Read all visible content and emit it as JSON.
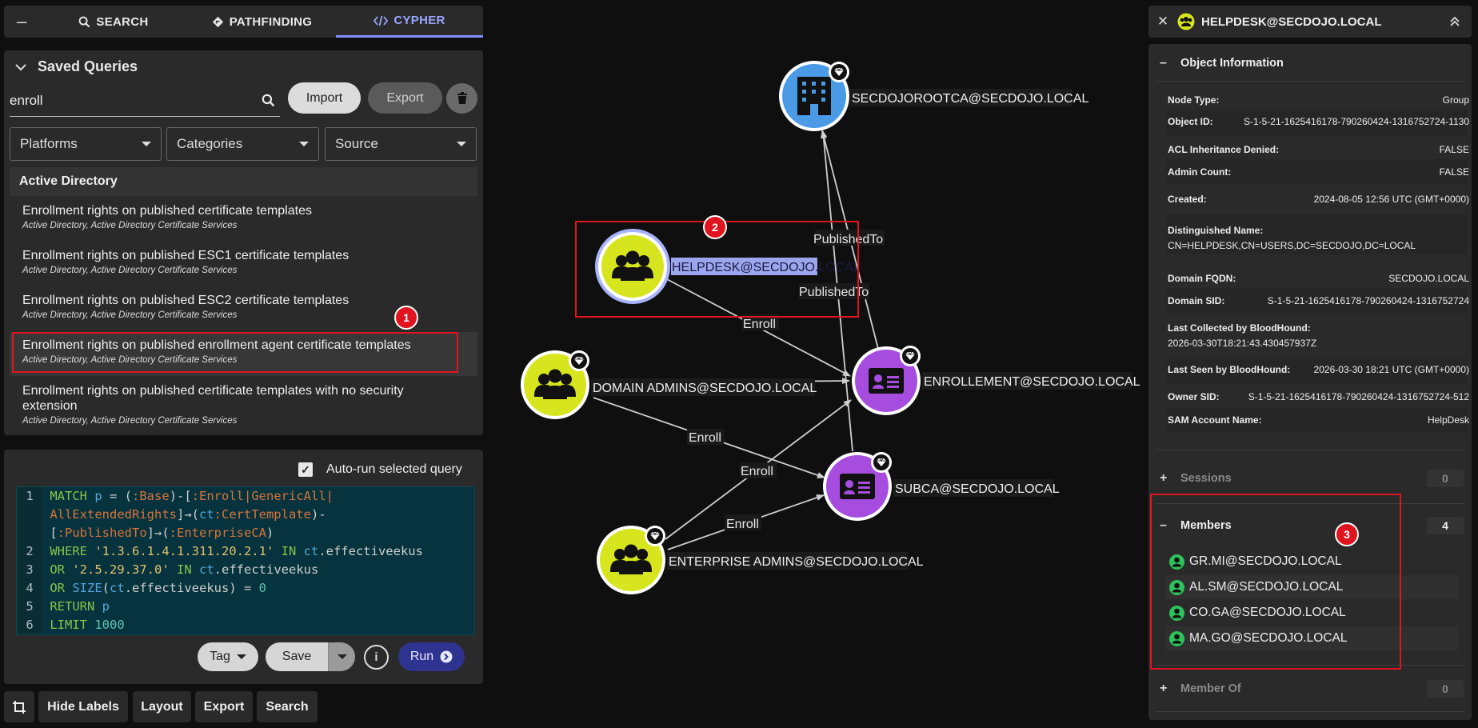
{
  "tabs": [
    {
      "label": "SEARCH"
    },
    {
      "label": "PATHFINDING"
    },
    {
      "label": "CYPHER"
    }
  ],
  "saved_queries": {
    "title": "Saved Queries",
    "search_value": "enroll",
    "import_label": "Import",
    "export_label": "Export",
    "filters": {
      "platforms": "Platforms",
      "categories": "Categories",
      "source": "Source"
    },
    "group_heading": "Active Directory",
    "items": [
      {
        "title": "Enrollment rights on published certificate templates",
        "subtitle": "Active Directory, Active Directory Certificate Services"
      },
      {
        "title": "Enrollment rights on published ESC1 certificate templates",
        "subtitle": "Active Directory, Active Directory Certificate Services"
      },
      {
        "title": "Enrollment rights on published ESC2 certificate templates",
        "subtitle": "Active Directory, Active Directory Certificate Services"
      },
      {
        "title": "Enrollment rights on published enrollment agent certificate templates",
        "subtitle": "Active Directory, Active Directory Certificate Services"
      },
      {
        "title": "Enrollment rights on published certificate templates with no security extension",
        "subtitle": "Active Directory, Active Directory Certificate Services"
      }
    ]
  },
  "cypher": {
    "autorun_label": "Auto-run selected query",
    "autorun_checked": true,
    "line_numbers": [
      "1",
      "2",
      "3",
      "4",
      "5",
      "6"
    ],
    "tokens": {
      "l1a_kw": "MATCH ",
      "l1a_var": "p",
      "l1a_op": " = (",
      "l1a_lbl1": ":Base",
      "l1a_op2": ")-[",
      "l1a_lbl2": ":Enroll|GenericAll|",
      "l1b_lbl": "AllExtendedRights",
      "l1b_op": "]→(",
      "l1b_var": "ct",
      "l1b_lbl2": ":CertTemplate",
      "l1b_op2": ")-",
      "l1c_op": "[",
      "l1c_lbl": ":PublishedTo",
      "l1c_op2": "]→(",
      "l1c_lbl2": ":EnterpriseCA",
      "l1c_op3": ")",
      "l2_kw": "WHERE ",
      "l2_str": "'1.3.6.1.4.1.311.20.2.1'",
      "l2_kw2": " IN ",
      "l2_var": "ct",
      "l2_prop": ".effectiveekus",
      "l3_kw": "OR ",
      "l3_str": "'2.5.29.37.0'",
      "l3_kw2": " IN ",
      "l3_var": "ct",
      "l3_prop": ".effectiveekus",
      "l4_kw": "OR ",
      "l4_fn": "SIZE",
      "l4_op": "(",
      "l4_var": "ct",
      "l4_prop": ".effectiveekus) = ",
      "l4_num": "0",
      "l5_kw": "RETURN ",
      "l5_var": "p",
      "l6_kw": "LIMIT ",
      "l6_num": "1000"
    },
    "tag_label": "Tag",
    "save_label": "Save",
    "run_label": "Run"
  },
  "bottom_toolbar": {
    "hide_labels": "Hide Labels",
    "layout": "Layout",
    "export": "Export",
    "search": "Search"
  },
  "graph": {
    "nodes": {
      "rootca": "SECDOJOROOTCA@SECDOJO.LOCAL",
      "helpdesk": "HELPDESK@SECDOJO.LOCAL",
      "domain_admins": "DOMAIN ADMINS@SECDOJO.LOCAL",
      "enrollement": "ENROLLEMENT@SECDOJO.LOCAL",
      "subca": "SUBCA@SECDOJO.LOCAL",
      "enterprise_admins": "ENTERPRISE ADMINS@SECDOJO.LOCAL"
    },
    "edge_labels": {
      "published_to_1": "PublishedTo",
      "published_to_2": "PublishedTo",
      "enroll_helpdesk": "Enroll",
      "enroll_da_subca": "Enroll",
      "enroll_ea_enr": "Enroll",
      "enroll_ea_subca": "Enroll"
    },
    "colors": {
      "group": "#d7e51f",
      "ca_blue": "#4a9ae6",
      "template_purple": "#a64de0"
    }
  },
  "right_panel": {
    "title": "HELPDESK@SECDOJO.LOCAL",
    "object_info_title": "Object Information",
    "properties": [
      {
        "key": "Node Type:",
        "value": "Group"
      },
      {
        "key": "Object ID:",
        "value": "S-1-5-21-1625416178-790260424-1316752724-1130"
      },
      {
        "key": "ACL Inheritance Denied:",
        "value": "FALSE"
      },
      {
        "key": "Admin Count:",
        "value": "FALSE"
      },
      {
        "key": "Created:",
        "value": "2024-08-05 12:56 UTC (GMT+0000)"
      },
      {
        "key": "Distinguished Name:",
        "value": "CN=HELPDESK,CN=USERS,DC=SECDOJO,DC=LOCAL"
      },
      {
        "key": "Domain FQDN:",
        "value": "SECDOJO.LOCAL"
      },
      {
        "key": "Domain SID:",
        "value": "S-1-5-21-1625416178-790260424-1316752724"
      },
      {
        "key": "Last Collected by BloodHound:",
        "value": "2026-03-30T18:21:43.430457937Z"
      },
      {
        "key": "Last Seen by BloodHound:",
        "value": "2026-03-30 18:21 UTC (GMT+0000)"
      },
      {
        "key": "Owner SID:",
        "value": "S-1-5-21-1625416178-790260424-1316752724-512"
      },
      {
        "key": "SAM Account Name:",
        "value": "HelpDesk"
      }
    ],
    "sessions": {
      "label": "Sessions",
      "count": "0"
    },
    "members": {
      "label": "Members",
      "count": "4",
      "items": [
        "GR.MI@SECDOJO.LOCAL",
        "AL.SM@SECDOJO.LOCAL",
        "CO.GA@SECDOJO.LOCAL",
        "MA.GO@SECDOJO.LOCAL"
      ]
    },
    "member_of": {
      "label": "Member Of",
      "count": "0"
    }
  },
  "annotations": {
    "badge1": "1",
    "badge2": "2",
    "badge3": "3"
  }
}
